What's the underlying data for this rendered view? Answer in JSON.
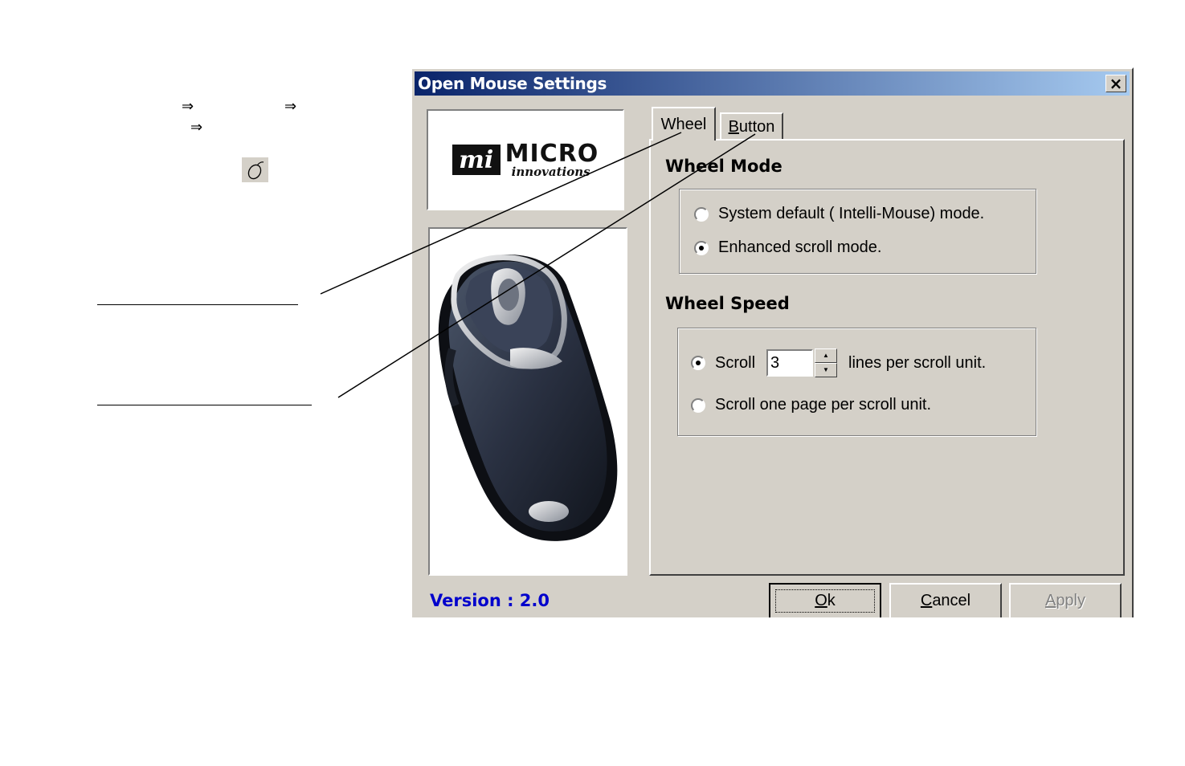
{
  "doc": {
    "arrow_symbol": "⇒"
  },
  "dialog": {
    "title": "Open Mouse Settings",
    "close_symbol": "×",
    "logo": {
      "initials": "mi",
      "word1": "MICRO",
      "word2": "innovations"
    },
    "version_text": "Version : 2.0",
    "tabs": [
      {
        "label_prefix": "Wheel",
        "label_underline": "",
        "label_rest": ""
      },
      {
        "label_prefix": "",
        "label_underline": "B",
        "label_rest": "utton"
      }
    ],
    "wheel_mode": {
      "title": "Wheel Mode",
      "options": [
        {
          "label": "System default ( Intelli-Mouse) mode.",
          "checked": false
        },
        {
          "label": "Enhanced scroll mode.",
          "checked": true
        }
      ]
    },
    "wheel_speed": {
      "title": "Wheel Speed",
      "scroll_label": "Scroll",
      "scroll_value": "3",
      "scroll_suffix": "lines per scroll unit.",
      "page_label": "Scroll one page per scroll unit.",
      "scroll_checked": true
    },
    "buttons": {
      "ok": {
        "u": "O",
        "rest": "k"
      },
      "cancel": {
        "u": "C",
        "rest": "ancel"
      },
      "apply": {
        "u": "A",
        "rest": "pply"
      }
    }
  }
}
